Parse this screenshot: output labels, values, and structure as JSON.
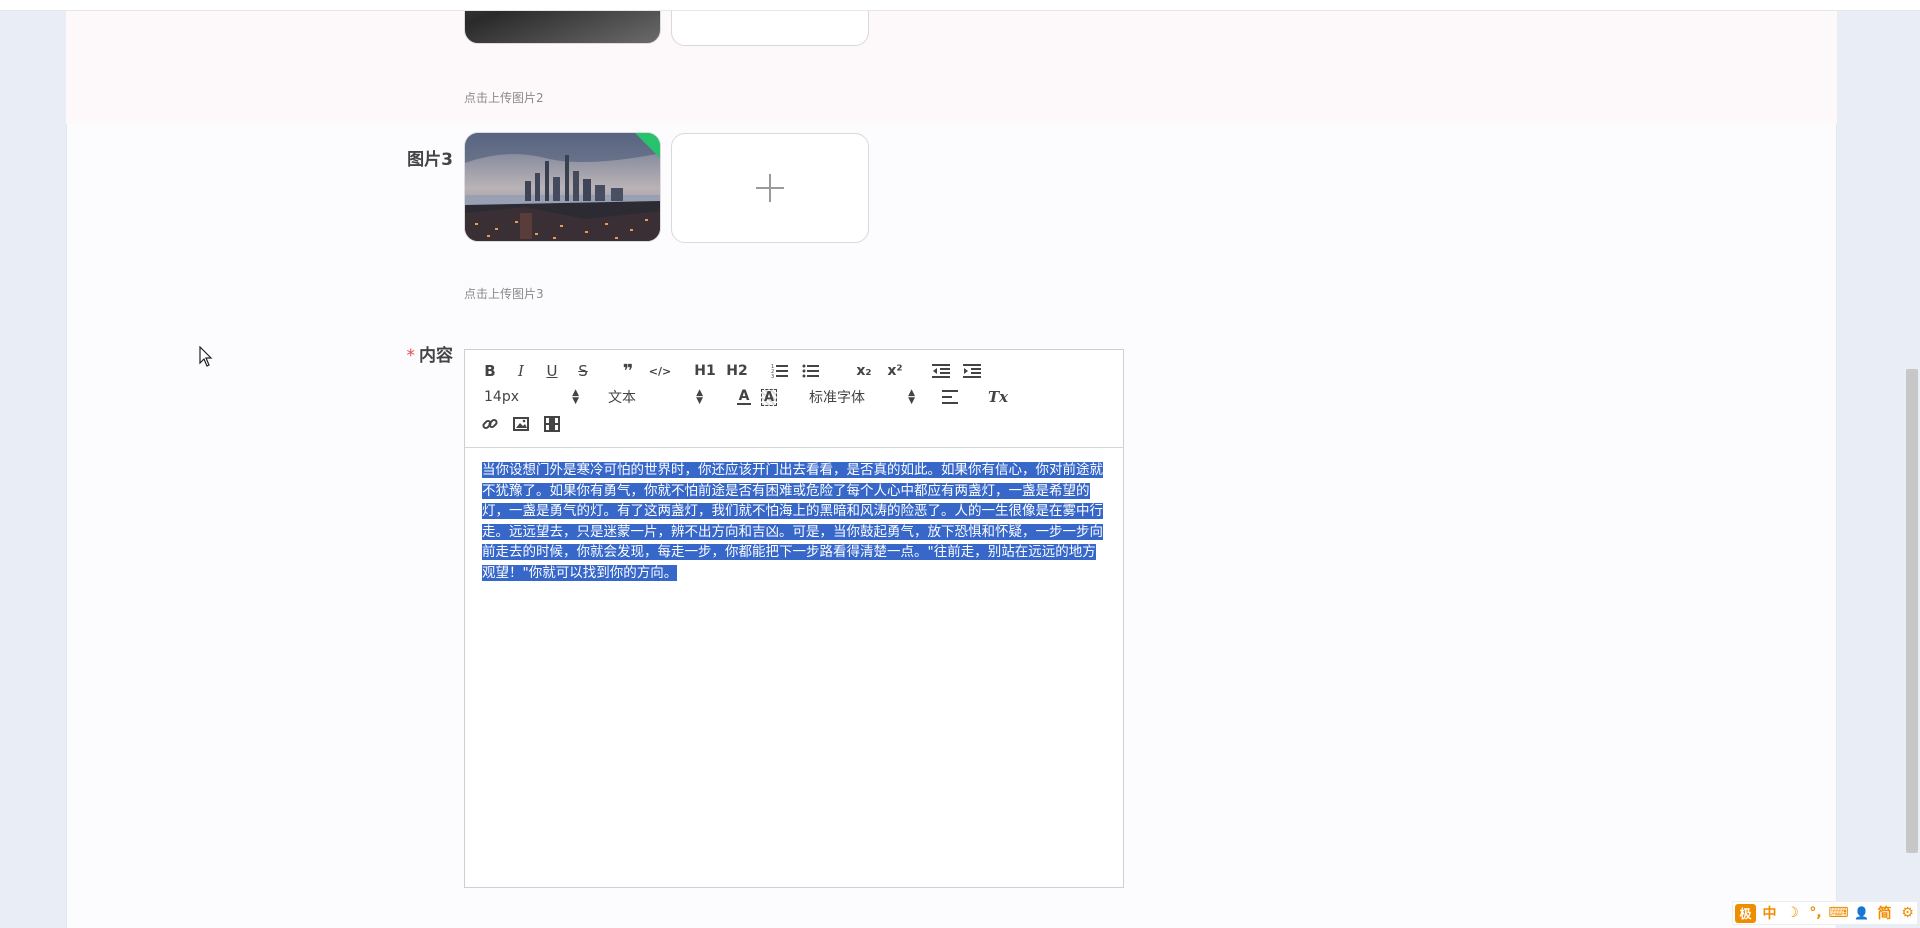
{
  "upload2": {
    "hint": "点击上传图片2"
  },
  "upload3": {
    "label": "图片3",
    "hint": "点击上传图片3",
    "add_icon": "plus-icon"
  },
  "content_field": {
    "required_mark": "*",
    "label": "内容"
  },
  "toolbar": {
    "bold": "B",
    "italic": "I",
    "underline": "U",
    "strike": "S",
    "quote": "❞",
    "code": "</>",
    "h1": "H1",
    "h2": "H2",
    "sub": "x₂",
    "sup": "x²",
    "clean": "Tx",
    "size_value": "14px",
    "type_value": "文本",
    "font_value": "标准字体"
  },
  "editor_text": "当你设想门外是寒冷可怕的世界时，你还应该开门出去看看，是否真的如此。如果你有信心，你对前途就不犹豫了。如果你有勇气，你就不怕前途是否有困难或危险了每个人心中都应有两盏灯，一盏是希望的灯，一盏是勇气的灯。有了这两盏灯，我们就不怕海上的黑暗和风涛的险恶了。人的一生很像是在雾中行走。远远望去，只是迷蒙一片，辨不出方向和吉凶。可是，当你鼓起勇气，放下恐惧和怀疑，一步一步向前走去的时候，你就会发现，每走一步，你都能把下一步路看得清楚一点。\"往前走，别站在远远的地方观望！\"你就可以找到你的方向。",
  "ime_bar": {
    "logo": "极",
    "mode": "中",
    "moon": "☽",
    "punct": "°,",
    "keyboard": "⌨",
    "user": "👤",
    "simp": "简",
    "gear": "⚙"
  }
}
